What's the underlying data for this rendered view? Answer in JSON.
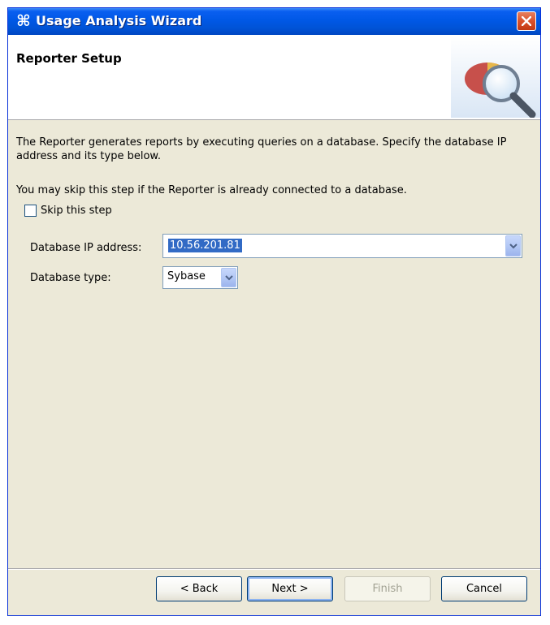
{
  "window": {
    "title": "Usage Analysis Wizard"
  },
  "header": {
    "title": "Reporter Setup"
  },
  "content": {
    "paragraph1": "The Reporter generates reports by executing queries on a database. Specify the database IP address and its type below.",
    "paragraph2": "You may skip this step if the Reporter is already connected to a database.",
    "skip_checkbox": {
      "label": "Skip this step",
      "checked": false
    },
    "ip_field": {
      "label": "Database IP address:",
      "value": "10.56.201.81"
    },
    "type_field": {
      "label": "Database type:",
      "value": "Sybase"
    }
  },
  "buttons": {
    "back": "< Back",
    "next": "Next >",
    "finish": "Finish",
    "cancel": "Cancel"
  },
  "colors": {
    "titlebar": "#0053d6",
    "dialog_bg": "#ece9d8",
    "selection": "#316ac5"
  },
  "icons": {
    "app": "wizard-app-icon",
    "close": "close-icon",
    "header": "database-search-icon",
    "dropdown": "chevron-down-icon"
  }
}
